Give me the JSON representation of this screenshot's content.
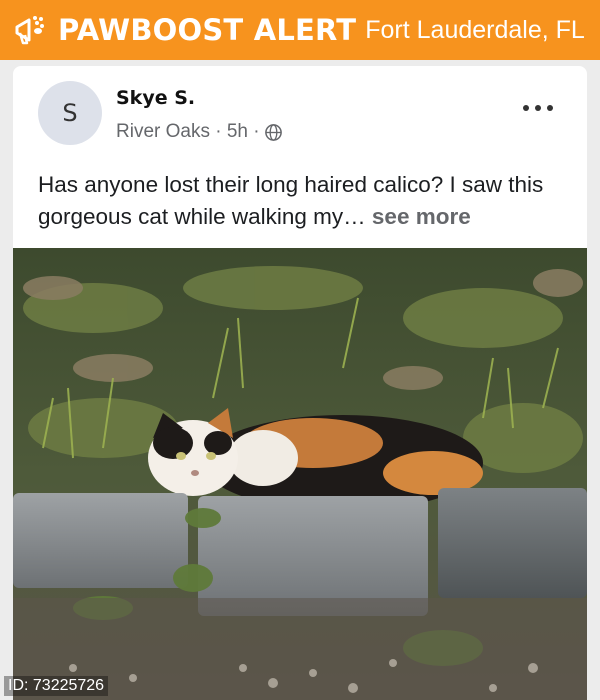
{
  "banner": {
    "logo_icon": "megaphone-paw-icon",
    "brand": "PAWBOOST ALERT",
    "location": "Fort Lauderdale, FL",
    "color": "#f7931e"
  },
  "post": {
    "avatar_initial": "S",
    "author": "Skye S.",
    "meta": "River Oaks · 5h ·",
    "privacy_icon": "globe-icon",
    "menu_icon": "more-options-icon",
    "text": "Has anyone lost their long haired calico? I saw this gorgeous cat while walking my…",
    "see_more": "see more"
  },
  "photo": {
    "subject": "calico-cat-photo"
  },
  "footer": {
    "id_label": "ID: 73225726"
  }
}
